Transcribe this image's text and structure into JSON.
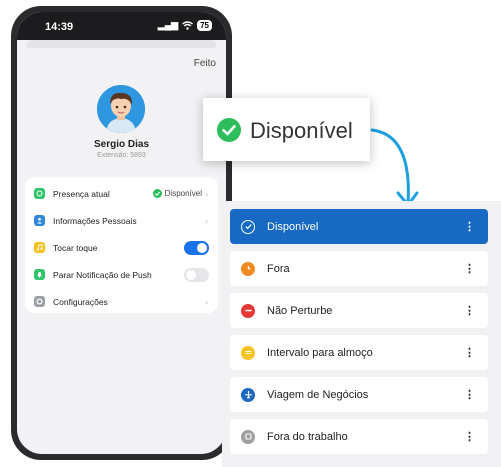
{
  "status_bar": {
    "time": "14:39",
    "signal": "▂▄▆",
    "wifi": "wifi",
    "battery": "75"
  },
  "profile": {
    "done_label": "Feito",
    "name": "Sergio Dias",
    "extension": "Extensão: 5893"
  },
  "menu": {
    "items": [
      {
        "label": "Presença atual",
        "value": "Disponível",
        "icon": "presence-icon",
        "color": "#31c46b"
      },
      {
        "label": "Informações Pessoais",
        "icon": "person-icon",
        "color": "#2f88dd"
      },
      {
        "label": "Tocar toque",
        "icon": "music-icon",
        "color": "#f5c21b",
        "toggle": true
      },
      {
        "label": "Parar Notificação de Push",
        "icon": "bell-icon",
        "color": "#31c46b",
        "toggle": false
      },
      {
        "label": "Configurações",
        "icon": "gear-icon",
        "color": "#9aa0a6"
      }
    ]
  },
  "callout": {
    "label": "Disponível"
  },
  "presence_list": [
    {
      "label": "Disponível",
      "color": "#43c24e",
      "selected": true,
      "icon": "check-icon"
    },
    {
      "label": "Fora",
      "color": "#f08a23",
      "icon": "clock-icon"
    },
    {
      "label": "Não Perturbe",
      "color": "#e53935",
      "icon": "minus-icon"
    },
    {
      "label": "Intervalo para almoço",
      "color": "#f7c21e",
      "icon": "lunch-icon"
    },
    {
      "label": "Viagem de Negócios",
      "color": "#1c67c0",
      "icon": "plane-icon"
    },
    {
      "label": "Fora do trabalho",
      "color": "#9e9e9e",
      "icon": "offwork-icon"
    }
  ],
  "colors": {
    "accent": "#1769c4",
    "toggle_on": "#1a73e8",
    "toggle_off": "#e5e5ea"
  }
}
